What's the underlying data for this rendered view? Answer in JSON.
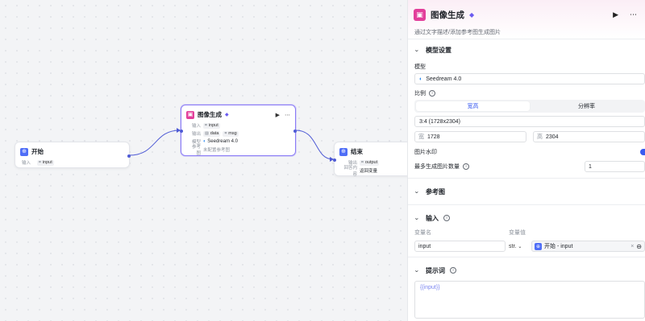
{
  "canvas": {
    "start_node": {
      "title": "开始",
      "row_label": "输入",
      "var": "input"
    },
    "image_node": {
      "title": "图像生成",
      "rows": [
        {
          "label": "输入",
          "chips": [
            "input"
          ]
        },
        {
          "label": "输出",
          "chips": [
            "data",
            "msg"
          ]
        },
        {
          "label": "模型",
          "text": "Seedream 4.0"
        },
        {
          "label": "参考图",
          "text": "未配置参考图"
        }
      ]
    },
    "end_node": {
      "title": "结束",
      "rows": [
        {
          "label": "输出",
          "chip": "output"
        },
        {
          "label": "回答内容",
          "text": "返回变量"
        }
      ]
    }
  },
  "panel": {
    "title": "图像生成",
    "description": "通过文字描述/添加参考图生成图片",
    "model_section": {
      "title": "模型设置",
      "model_label": "模型",
      "model_value": "Seedream 4.0",
      "ratio_label": "比例",
      "tabs": [
        "宽高",
        "分辨率"
      ],
      "ratio_value": "3:4 (1728x2304)",
      "width_prefix": "宽",
      "width_value": "1728",
      "height_prefix": "高",
      "height_value": "2304",
      "watermark_label": "图片水印",
      "max_label": "最多生成图片数量",
      "max_value": "1"
    },
    "ref_section": {
      "title": "参考图"
    },
    "input_section": {
      "title": "输入",
      "col_name": "变量名",
      "col_value": "变量值",
      "var_name": "input",
      "var_type": "str.",
      "var_value": "开始 - input"
    },
    "prompt_section": {
      "title": "提示词",
      "value": "{{input}}"
    }
  },
  "colors": {
    "accent": "#3a5bf0",
    "brand_pink": "#e23f9b",
    "wire": "#4f5bd5"
  }
}
